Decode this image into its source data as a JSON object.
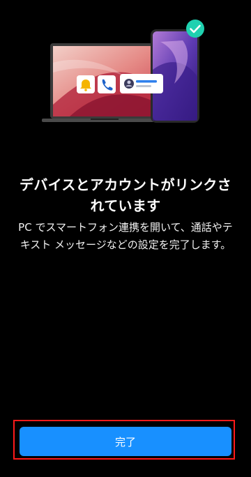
{
  "title": "デバイスとアカウントがリンクされています",
  "description": "PC でスマートフォン連携を開いて、通話やテキスト メッセージなどの設定を完了します。",
  "done_button": {
    "label": "完了"
  },
  "hero": {
    "icons": [
      "bell-icon",
      "phone-call-icon",
      "contact-avatar-icon",
      "checkmark-icon"
    ]
  },
  "colors": {
    "background": "#000000",
    "primary_button": "#1890ff",
    "highlight_border": "#ff1a1a",
    "check_badge": "#1fd1b0"
  }
}
